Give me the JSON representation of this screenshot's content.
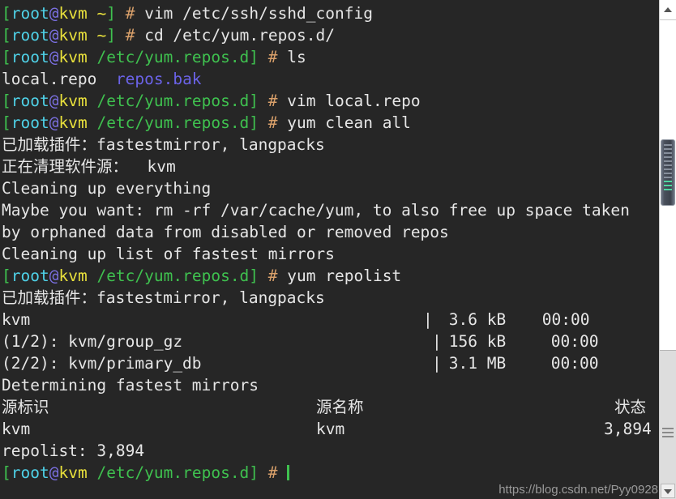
{
  "terminal": {
    "background_color": "#262626",
    "foreground_color": "#e6e6e6",
    "prompt": {
      "user": "root",
      "at": "@",
      "host": "kvm",
      "open_bracket": "[",
      "close_bracket": "]",
      "hash": "#",
      "path_home": "~",
      "path_repos": "/etc/yum.repos.d"
    },
    "colors": {
      "bracket": "#3fc14f",
      "user": "#4fd2e8",
      "at": "#7a6fe0",
      "host": "#e8e03c",
      "path": "#3fc14f",
      "hash": "#d9a06a",
      "directory": "#6b63e8",
      "cursor": "#3fc14f"
    },
    "commands": {
      "vim_sshd": "vim /etc/ssh/sshd_config",
      "cd_repos": "cd /etc/yum.repos.d/",
      "ls": "ls",
      "vim_local": "vim local.repo",
      "yum_clean": "yum clean all",
      "yum_repolist": "yum repolist"
    },
    "ls_output": {
      "file": "local.repo",
      "gap": "  ",
      "directory": "repos.bak"
    },
    "clean_output": {
      "plugins_loaded": "已加载插件：fastestmirror, langpacks",
      "cleaning_repo": "正在清理软件源：  kvm",
      "cleaning_everything": "Cleaning up everything",
      "maybe_line1": "Maybe you want: rm -rf /var/cache/yum, to also free up space taken",
      "maybe_line2": "by orphaned data from disabled or removed repos",
      "cleaning_mirrors": "Cleaning up list of fastest mirrors"
    },
    "repolist_output": {
      "plugins_loaded": "已加载插件：fastestmirror, langpacks",
      "downloads": [
        {
          "name": "kvm",
          "bar": "|",
          "size": "3.6 kB",
          "time": "00:00"
        },
        {
          "name": "(1/2): kvm/group_gz",
          "bar": "|",
          "size": "156 kB",
          "time": "00:00"
        },
        {
          "name": "(2/2): kvm/primary_db",
          "bar": "|",
          "size": "3.1 MB",
          "time": "00:00"
        }
      ],
      "determining": "Determining fastest mirrors",
      "table_headers": {
        "repo_id": "源标识",
        "repo_name": "源名称",
        "status": "状态"
      },
      "table_rows": [
        {
          "repo_id": "kvm",
          "repo_name": "kvm",
          "status": "3,894"
        }
      ],
      "summary": "repolist: 3,894"
    }
  },
  "watermark": {
    "text": "https://blog.csdn.net/Pyy0928"
  },
  "scrollbar": {
    "up_arrow_icon": "chevron-up-icon",
    "down_arrow_icon": "chevron-down-icon",
    "grip_icon": "grip-lines-icon",
    "thumb_icon": "scrollbar-thumb"
  }
}
